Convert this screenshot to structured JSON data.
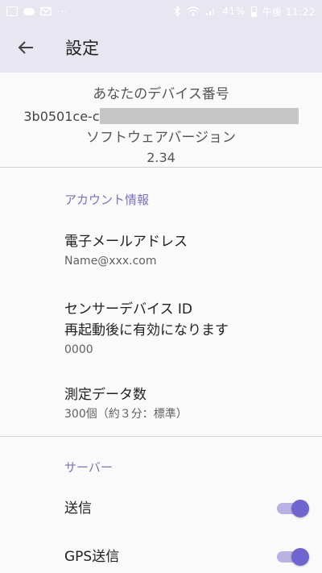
{
  "status_bar": {
    "battery": "41%",
    "time": "午後 11:22"
  },
  "app_bar": {
    "title": "設定"
  },
  "device_info": {
    "device_number_label": "あなたのデバイス番号",
    "device_number_prefix": "3b0501ce-c",
    "software_version_label": "ソフトウェアバージョン",
    "software_version": "2.34"
  },
  "account": {
    "header": "アカウント情報",
    "email_title": "電子メールアドレス",
    "email_value": "Name@xxx.com",
    "sensor_title_line1": "センサーデバイス ID",
    "sensor_title_line2": "再起動後に有効になります",
    "sensor_value": "0000",
    "measurement_title": "測定データ数",
    "measurement_value": "300個（約３分：標準）"
  },
  "server": {
    "header": "サーバー",
    "send_label": "送信",
    "send_enabled": true,
    "gps_label": "GPS送信",
    "gps_enabled": true
  },
  "colors": {
    "accent": "#7064cf",
    "accent_track": "#b9b2e2",
    "header_text": "#7b72b8",
    "app_bar_bg": "#e8e6f0"
  }
}
